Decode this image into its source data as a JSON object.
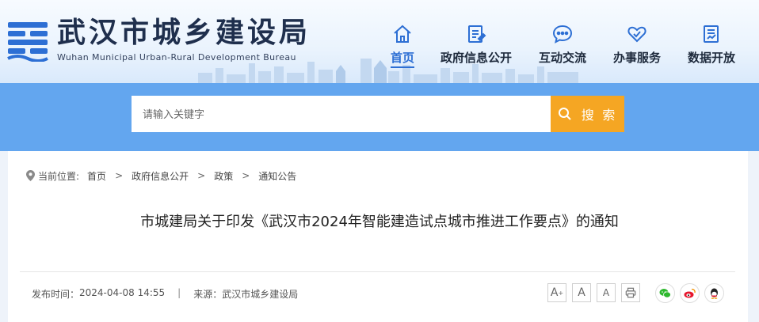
{
  "header": {
    "title": "武汉市城乡建设局",
    "subtitle": "Wuhan Municipal Urban-Rural Development Bureau",
    "brand_color": "#2d6fd4",
    "nav": [
      {
        "label": "首页",
        "icon": "home-icon",
        "active": true
      },
      {
        "label": "政府信息公开",
        "icon": "document-icon",
        "active": false
      },
      {
        "label": "互动交流",
        "icon": "chat-icon",
        "active": false
      },
      {
        "label": "办事服务",
        "icon": "heart-hand-icon",
        "active": false
      },
      {
        "label": "数据开放",
        "icon": "data-doc-icon",
        "active": false
      }
    ]
  },
  "search": {
    "placeholder": "请输入关键字",
    "button_label": "搜 索",
    "button_color": "#f5a623",
    "band_color": "#63a6ef"
  },
  "breadcrumb": {
    "prefix": "当前位置:",
    "items": [
      "首页",
      "政府信息公开",
      "政策",
      "通知公告"
    ],
    "separator": ">"
  },
  "article": {
    "title": "市城建局关于印发《武汉市2024年智能建造试点城市推进工作要点》的通知",
    "publish_label": "发布时间：",
    "publish_time": "2024-04-08 14:55",
    "source_label": "来源：",
    "source": "武汉市城乡建设局",
    "separator": "|"
  },
  "tools": {
    "font_large": "A",
    "font_large_sup": "+",
    "font_medium": "A",
    "font_small": "A",
    "print_icon": "print-icon",
    "share": [
      "wechat-icon",
      "weibo-icon",
      "qq-icon"
    ]
  }
}
